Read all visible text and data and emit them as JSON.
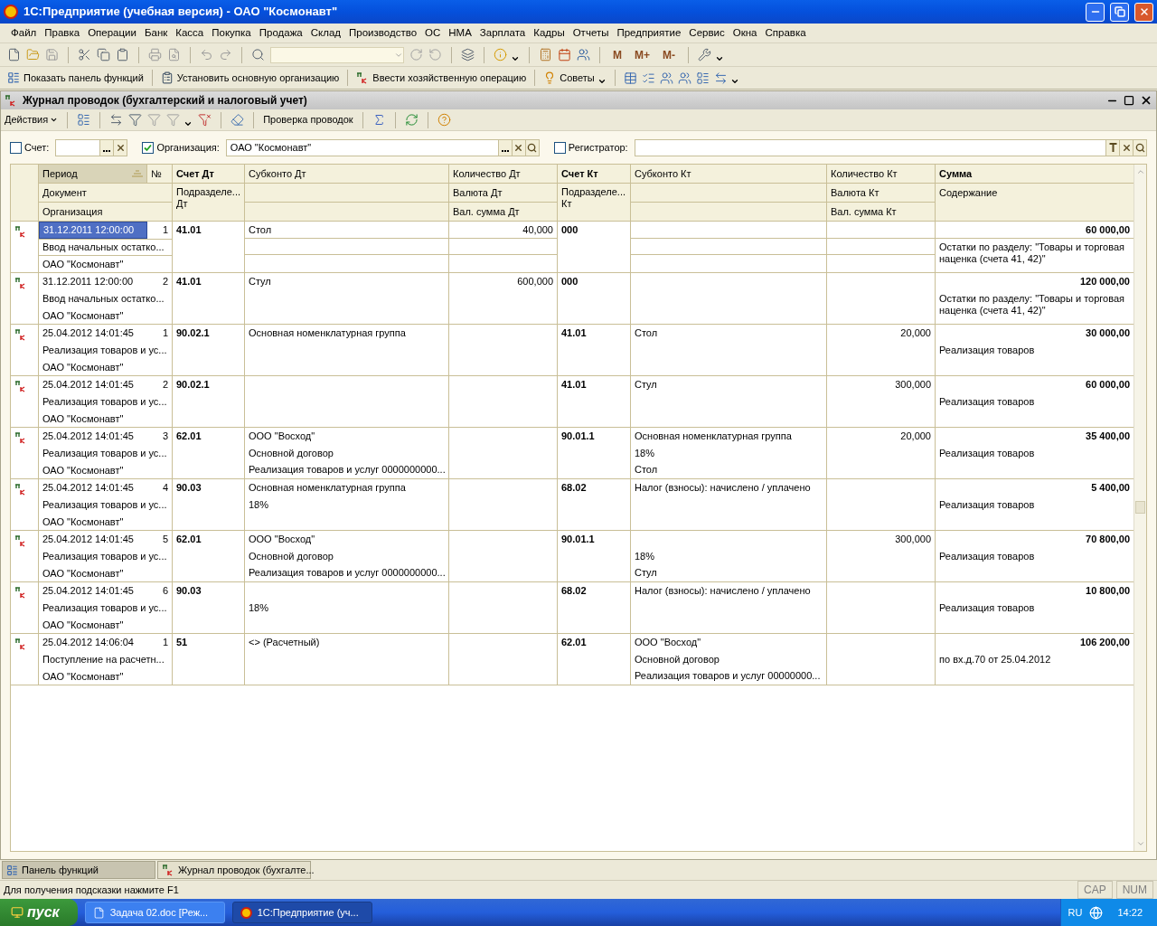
{
  "window": {
    "title": "1С:Предприятие (учебная версия) - ОАО \"Космонавт\""
  },
  "menu": [
    "Файл",
    "Правка",
    "Операции",
    "Банк",
    "Касса",
    "Покупка",
    "Продажа",
    "Склад",
    "Производство",
    "ОС",
    "НМА",
    "Зарплата",
    "Кадры",
    "Отчеты",
    "Предприятие",
    "Сервис",
    "Окна",
    "Справка"
  ],
  "toolbar": {
    "memory_buttons": [
      "M",
      "M+",
      "M-"
    ]
  },
  "command_bar": [
    "Показать панель функций",
    "Установить основную организацию",
    "Ввести хозяйственную операцию",
    "Советы"
  ],
  "document_window": {
    "title": "Журнал проводок (бухгалтерский и налоговый учет)",
    "actions_menu": "Действия",
    "check_button": "Проверка проводок"
  },
  "filters": [
    {
      "label": "Счет:",
      "checked": false
    },
    {
      "label": "Организация:",
      "checked": true,
      "value": "ОАО \"Космонавт\""
    },
    {
      "label": "Регистратор:",
      "checked": false
    }
  ],
  "table": {
    "columns": [
      {
        "kind": "period",
        "labels": [
          "Период",
          "№",
          "Документ",
          "Организация"
        ],
        "sorted": true
      },
      {
        "kind": "account",
        "labels": [
          "Счет Дт",
          "Подразделе... Дт"
        ]
      },
      {
        "kind": "subconto",
        "labels": [
          "Субконто Дт"
        ]
      },
      {
        "kind": "quantity",
        "labels": [
          "Количество Дт",
          "Валюта Дт",
          "Вал. сумма Дт"
        ]
      },
      {
        "kind": "account",
        "labels": [
          "Счет Кт",
          "Подразделе... Кт"
        ]
      },
      {
        "kind": "subconto",
        "labels": [
          "Субконто Кт"
        ]
      },
      {
        "kind": "quantity",
        "labels": [
          "Количество Кт",
          "Валюта Кт",
          "Вал. сумма Кт"
        ]
      },
      {
        "kind": "sum",
        "labels": [
          "Сумма",
          "Содержание"
        ]
      }
    ],
    "rows": [
      {
        "selected": true,
        "period": "31.12.2011 12:00:00",
        "number": "1",
        "document": "Ввод начальных остатко...",
        "organization": "ОАО \"Космонавт\"",
        "account_dt": "41.01",
        "subconto_dt": [
          "Стол"
        ],
        "quantity_dt": "40,000",
        "account_kt": "000",
        "sum": "60 000,00",
        "content": "Остатки по разделу: \"Товары и торговая наценка (счета 41, 42)\""
      },
      {
        "selected": false,
        "period": "31.12.2011 12:00:00",
        "number": "2",
        "document": "Ввод начальных остатко...",
        "organization": "ОАО \"Космонавт\"",
        "account_dt": "41.01",
        "subconto_dt": [
          "Стул"
        ],
        "quantity_dt": "600,000",
        "account_kt": "000",
        "sum": "120 000,00",
        "content": "Остатки по разделу: \"Товары и торговая наценка (счета 41, 42)\""
      },
      {
        "selected": false,
        "period": "25.04.2012 14:01:45",
        "number": "1",
        "document": "Реализация товаров и ус...",
        "organization": "ОАО \"Космонавт\"",
        "account_dt": "90.02.1",
        "subconto_dt": [
          "Основная номенклатурная группа"
        ],
        "account_kt": "41.01",
        "subconto_kt": [
          "Стол"
        ],
        "quantity_kt": "20,000",
        "sum": "30 000,00",
        "content": "Реализация товаров"
      },
      {
        "selected": false,
        "period": "25.04.2012 14:01:45",
        "number": "2",
        "document": "Реализация товаров и ус...",
        "organization": "ОАО \"Космонавт\"",
        "account_dt": "90.02.1",
        "account_kt": "41.01",
        "subconto_kt": [
          "Стул"
        ],
        "quantity_kt": "300,000",
        "sum": "60 000,00",
        "content": "Реализация товаров"
      },
      {
        "selected": false,
        "period": "25.04.2012 14:01:45",
        "number": "3",
        "document": "Реализация товаров и ус...",
        "organization": "ОАО \"Космонавт\"",
        "account_dt": "62.01",
        "subconto_dt": [
          "ООО \"Восход\"",
          "Основной договор",
          "Реализация товаров и услуг 0000000000..."
        ],
        "account_kt": "90.01.1",
        "subconto_kt": [
          "Основная номенклатурная группа",
          "18%",
          "Стол"
        ],
        "quantity_kt": "20,000",
        "sum": "35 400,00",
        "content": "Реализация товаров"
      },
      {
        "selected": false,
        "period": "25.04.2012 14:01:45",
        "number": "4",
        "document": "Реализация товаров и ус...",
        "organization": "ОАО \"Космонавт\"",
        "account_dt": "90.03",
        "subconto_dt": [
          "Основная номенклатурная группа",
          "18%"
        ],
        "account_kt": "68.02",
        "subconto_kt": [
          "Налог (взносы): начислено / уплачено"
        ],
        "sum": "5 400,00",
        "content": "Реализация товаров"
      },
      {
        "selected": false,
        "period": "25.04.2012 14:01:45",
        "number": "5",
        "document": "Реализация товаров и ус...",
        "organization": "ОАО \"Космонавт\"",
        "account_dt": "62.01",
        "subconto_dt": [
          "ООО \"Восход\"",
          "Основной договор",
          "Реализация товаров и услуг 0000000000..."
        ],
        "account_kt": "90.01.1",
        "subconto_kt": {
          "line_2": "18%",
          "line_3": "Стул"
        },
        "quantity_kt": "300,000",
        "sum": "70 800,00",
        "content": "Реализация товаров"
      },
      {
        "selected": false,
        "period": "25.04.2012 14:01:45",
        "number": "6",
        "document": "Реализация товаров и ус...",
        "organization": "ОАО \"Космонавт\"",
        "account_dt": "90.03",
        "subconto_dt": {
          "line_2": "18%"
        },
        "account_kt": "68.02",
        "subconto_kt": [
          "Налог (взносы): начислено / уплачено"
        ],
        "sum": "10 800,00",
        "content": "Реализация товаров"
      },
      {
        "selected": false,
        "period": "25.04.2012 14:06:04",
        "number": "1",
        "document": "Поступление на расчетн...",
        "organization": "ОАО \"Космонавт\"",
        "account_dt": "51",
        "subconto_dt": [
          "<> (Расчетный)"
        ],
        "account_kt": "62.01",
        "subconto_kt": [
          "ООО \"Восход\"",
          "Основной договор",
          "Реализация товаров и услуг 00000000..."
        ],
        "sum": "106 200,00",
        "content": "по вх.д.70 от 25.04.2012"
      }
    ]
  },
  "window_tabs": [
    {
      "label": "Панель функций",
      "selected": false
    },
    {
      "label": "Журнал проводок (бухгалте...",
      "selected": true
    }
  ],
  "status_bar": {
    "hint": "Для получения подсказки нажмите F1",
    "indicators": [
      "CAP",
      "NUM"
    ]
  },
  "taskbar": {
    "start": "пуск",
    "tasks": [
      {
        "label": "Задача 02.doc [Реж...",
        "selected": false
      },
      {
        "label": "1С:Предприятие (уч...",
        "selected": true
      }
    ],
    "language": "RU",
    "clock": "14:22"
  }
}
